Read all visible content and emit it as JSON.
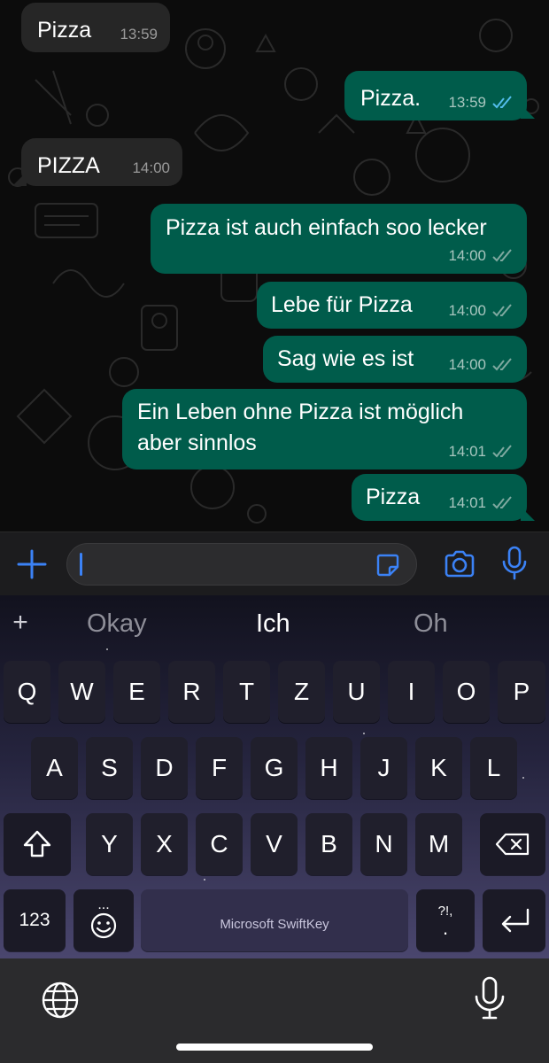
{
  "chat": {
    "messages": [
      {
        "direction": "incoming",
        "text": "Pizza",
        "time": "13:59"
      },
      {
        "direction": "outgoing",
        "text": "Pizza.",
        "time": "13:59",
        "status": "read"
      },
      {
        "direction": "incoming",
        "text": "PIZZA",
        "time": "14:00"
      },
      {
        "direction": "outgoing",
        "text": "Pizza ist auch einfach soo lecker",
        "time": "14:00",
        "status": "delivered"
      },
      {
        "direction": "outgoing",
        "text": "Lebe für Pizza",
        "time": "14:00",
        "status": "delivered"
      },
      {
        "direction": "outgoing",
        "text": "Sag wie es ist",
        "time": "14:00",
        "status": "delivered"
      },
      {
        "direction": "outgoing",
        "text": "Ein Leben ohne Pizza ist möglich\naber sinnlos",
        "time": "14:01",
        "status": "delivered"
      },
      {
        "direction": "outgoing",
        "text": "Pizza",
        "time": "14:01",
        "status": "delivered"
      }
    ]
  },
  "composer": {
    "input_value": "",
    "icons": [
      "plus-icon",
      "sticker-icon",
      "camera-icon",
      "microphone-icon"
    ],
    "accent_color": "#3b82f6"
  },
  "keyboard": {
    "suggestions": [
      "Okay",
      "Ich",
      "Oh"
    ],
    "rows": [
      [
        "Q",
        "W",
        "E",
        "R",
        "T",
        "Z",
        "U",
        "I",
        "O",
        "P"
      ],
      [
        "A",
        "S",
        "D",
        "F",
        "G",
        "H",
        "J",
        "K",
        "L"
      ],
      [
        "Y",
        "X",
        "C",
        "V",
        "B",
        "N",
        "M"
      ]
    ],
    "numbers_key": "123",
    "punct_key_top": "?!,",
    "punct_key_bottom": ".",
    "space_label": "Microsoft SwiftKey",
    "emoji_dots": "...",
    "icons": [
      "shift-icon",
      "backspace-icon",
      "emoji-icon",
      "return-icon"
    ]
  },
  "system_bar": {
    "icons": [
      "globe-icon",
      "microphone-icon"
    ]
  },
  "colors": {
    "outgoing_bubble": "#005c4b",
    "incoming_bubble": "#262626",
    "read_ticks": "#53bdeb"
  }
}
